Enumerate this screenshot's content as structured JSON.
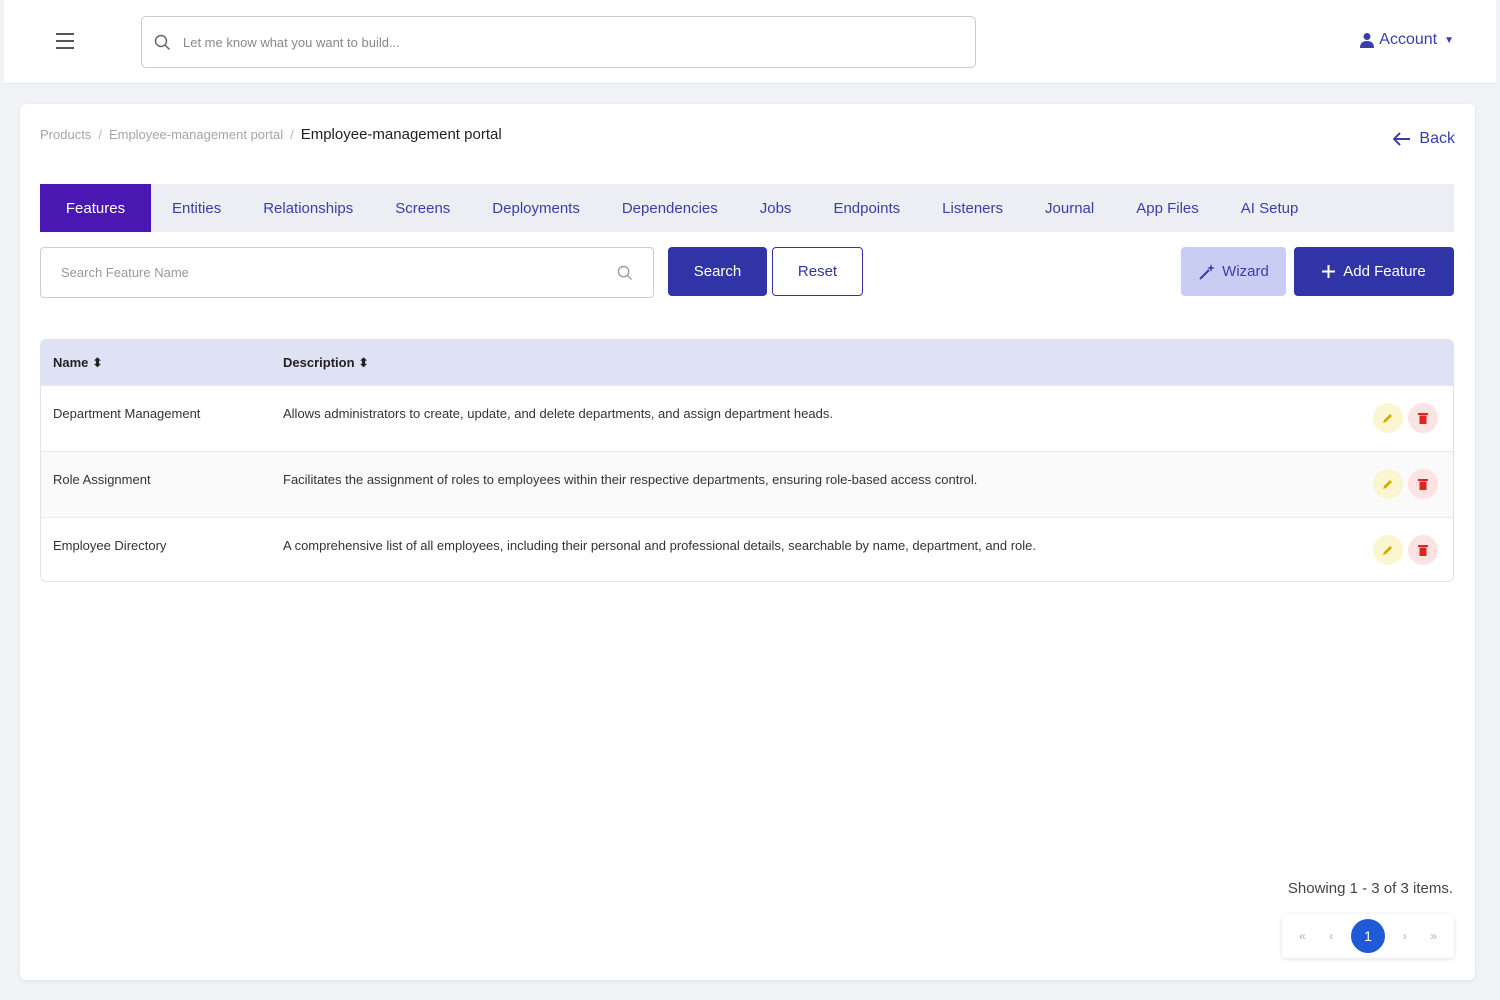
{
  "header": {
    "search_placeholder": "Let me know what you want to build...",
    "account_label": "Account"
  },
  "breadcrumb": {
    "items": [
      "Products",
      "Employee-management portal"
    ],
    "current": "Employee-management portal"
  },
  "back_label": "Back",
  "tabs": [
    {
      "label": "Features",
      "active": true
    },
    {
      "label": "Entities"
    },
    {
      "label": "Relationships"
    },
    {
      "label": "Screens"
    },
    {
      "label": "Deployments"
    },
    {
      "label": "Dependencies"
    },
    {
      "label": "Jobs"
    },
    {
      "label": "Endpoints"
    },
    {
      "label": "Listeners"
    },
    {
      "label": "Journal"
    },
    {
      "label": "App Files"
    },
    {
      "label": "AI Setup"
    }
  ],
  "toolbar": {
    "search_placeholder": "Search Feature Name",
    "search_label": "Search",
    "reset_label": "Reset",
    "wizard_label": "Wizard",
    "add_label": "Add Feature"
  },
  "table": {
    "columns": [
      "Name",
      "Description"
    ],
    "rows": [
      {
        "name": "Department Management",
        "description": "Allows administrators to create, update, and delete departments, and assign department heads."
      },
      {
        "name": "Role Assignment",
        "description": "Facilitates the assignment of roles to employees within their respective departments, ensuring role-based access control."
      },
      {
        "name": "Employee Directory",
        "description": "A comprehensive list of all employees, including their personal and professional details, searchable by name, department, and role."
      }
    ]
  },
  "pagination": {
    "summary": "Showing 1 - 3 of 3 items.",
    "first": "«",
    "prev": "‹",
    "current_page": "1",
    "next": "›",
    "last": "»"
  },
  "colors": {
    "primary": "#3034a6",
    "tab_active": "#4a17b3",
    "tab_bar": "#eceef3",
    "table_header": "#dfe2f4",
    "edit": "#e0b400",
    "delete": "#e02424",
    "page_active": "#1f5bd6"
  },
  "icons": [
    "menu-icon",
    "search-icon",
    "user-icon",
    "arrow-left-icon",
    "magic-wand-icon",
    "plus-icon",
    "sort-icon",
    "pencil-icon",
    "trash-icon"
  ]
}
